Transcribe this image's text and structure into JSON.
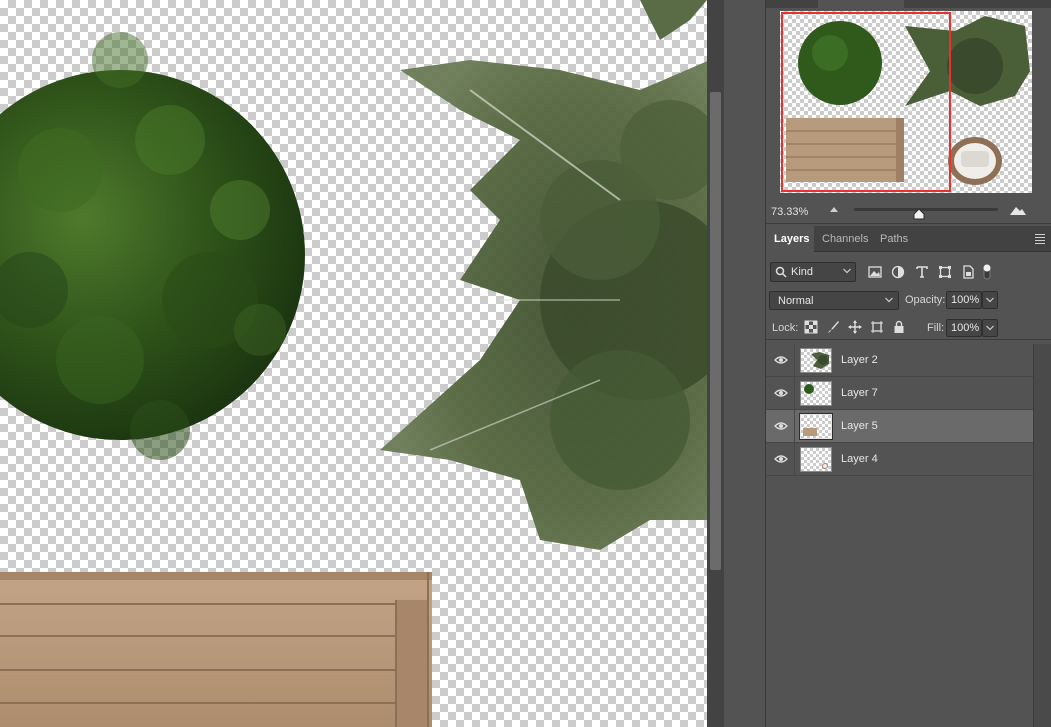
{
  "canvas": {
    "artwork": [
      "round boxwood shrub",
      "conifer tree top view",
      "wooden bench"
    ]
  },
  "navigator": {
    "zoom": "73.33%",
    "zoom_slider_fraction": 0.45
  },
  "layers_panel": {
    "tabs": [
      {
        "label": "Layers",
        "active": true
      },
      {
        "label": "Channels",
        "active": false
      },
      {
        "label": "Paths",
        "active": false
      }
    ],
    "filter": {
      "kind_label": "Kind"
    },
    "blend_mode": "Normal",
    "opacity_label": "Opacity:",
    "opacity": "100%",
    "lock_label": "Lock:",
    "fill_label": "Fill:",
    "fill": "100%",
    "layers": [
      {
        "name": "Layer 2",
        "visible": true,
        "selected": false,
        "thumb": "tree"
      },
      {
        "name": "Layer 7",
        "visible": true,
        "selected": false,
        "thumb": "shrub"
      },
      {
        "name": "Layer 5",
        "visible": true,
        "selected": true,
        "thumb": "bench"
      },
      {
        "name": "Layer 4",
        "visible": true,
        "selected": false,
        "thumb": "chair"
      }
    ]
  },
  "colors": {
    "panel_bg": "#535353",
    "selected_layer": "#6a6a6a",
    "navigator_view_box": "#e8322e",
    "shrub_green": "#2f4f1c",
    "tree_green": "#4a5f3a",
    "wood": "#b9987a"
  }
}
